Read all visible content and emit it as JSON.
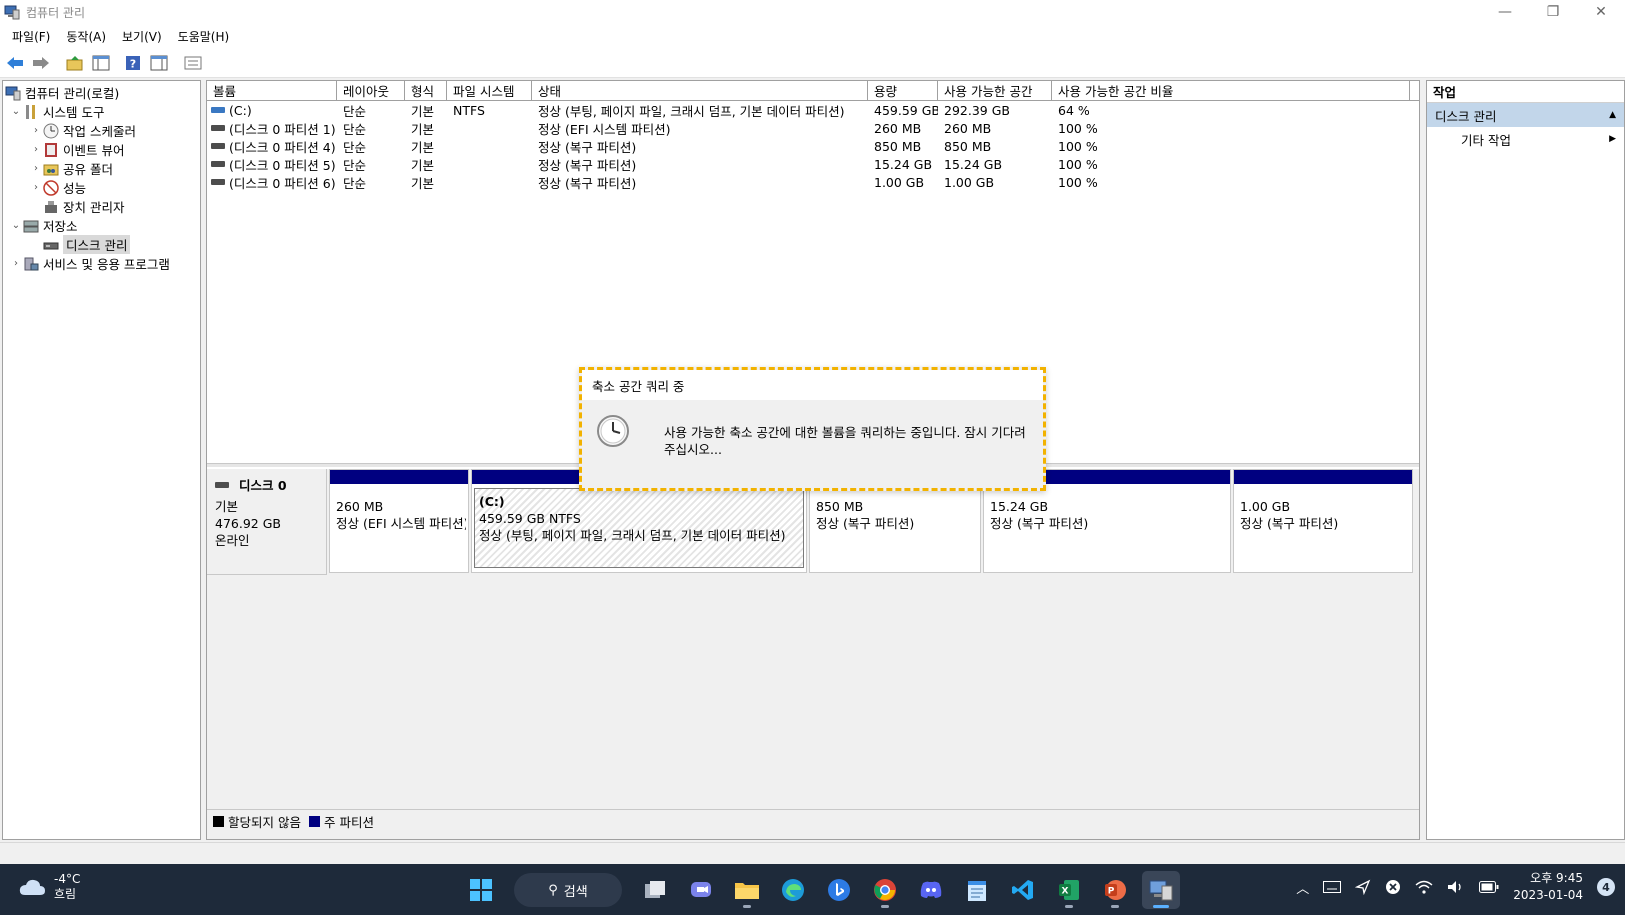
{
  "window": {
    "title": "컴퓨터 관리",
    "minimize": "—",
    "restore": "❐",
    "close": "✕"
  },
  "menu": [
    "파일(F)",
    "동작(A)",
    "보기(V)",
    "도움말(H)"
  ],
  "tree": {
    "root": "컴퓨터 관리(로컬)",
    "system_tools": "시스템 도구",
    "task_scheduler": "작업 스케줄러",
    "event_viewer": "이벤트 뷰어",
    "shared_folders": "공유 폴더",
    "performance": "성능",
    "device_manager": "장치 관리자",
    "storage": "저장소",
    "disk_management": "디스크 관리",
    "services_apps": "서비스 및 응용 프로그램"
  },
  "volumes": {
    "headers": [
      "볼륨",
      "레이아웃",
      "형식",
      "파일 시스템",
      "상태",
      "용량",
      "사용 가능한 공간",
      "사용 가능한 공간 비율"
    ],
    "rows": [
      [
        "(C:)",
        "단순",
        "기본",
        "NTFS",
        "정상 (부팅, 페이지 파일, 크래시 덤프, 기본 데이터 파티션)",
        "459.59 GB",
        "292.39 GB",
        "64 %"
      ],
      [
        "(디스크 0 파티션 1)",
        "단순",
        "기본",
        "",
        "정상 (EFI 시스템 파티션)",
        "260 MB",
        "260 MB",
        "100 %"
      ],
      [
        "(디스크 0 파티션 4)",
        "단순",
        "기본",
        "",
        "정상 (복구 파티션)",
        "850 MB",
        "850 MB",
        "100 %"
      ],
      [
        "(디스크 0 파티션 5)",
        "단순",
        "기본",
        "",
        "정상 (복구 파티션)",
        "15.24 GB",
        "15.24 GB",
        "100 %"
      ],
      [
        "(디스크 0 파티션 6)",
        "단순",
        "기본",
        "",
        "정상 (복구 파티션)",
        "1.00 GB",
        "1.00 GB",
        "100 %"
      ]
    ]
  },
  "disk": {
    "name": "디스크 0",
    "type": "기본",
    "size": "476.92 GB",
    "status": "온라인",
    "partitions": [
      {
        "name": "",
        "size": "260 MB",
        "status": "정상 (EFI 시스템 파티션)"
      },
      {
        "name": "(C:)",
        "size": "459.59 GB NTFS",
        "status": "정상 (부팅, 페이지 파일, 크래시 덤프, 기본 데이터 파티션)"
      },
      {
        "name": "",
        "size": "850 MB",
        "status": "정상 (복구 파티션)"
      },
      {
        "name": "",
        "size": "15.24 GB",
        "status": "정상 (복구 파티션)"
      },
      {
        "name": "",
        "size": "1.00 GB",
        "status": "정상 (복구 파티션)"
      }
    ]
  },
  "legend": {
    "unallocated": "할당되지 않음",
    "primary": "주 파티션",
    "unallocated_color": "#000000",
    "primary_color": "#000080"
  },
  "actions": {
    "header": "작업",
    "section": "디스크 관리",
    "more": "기타 작업"
  },
  "dialog": {
    "title": "축소 공간 쿼리 중",
    "message": "사용 가능한 축소 공간에 대한 볼륨을 쿼리하는 중입니다. 잠시 기다려 주십시오..."
  },
  "taskbar": {
    "temp": "-4°C",
    "weather": "흐림",
    "search": "검색",
    "time": "오후 9:45",
    "date": "2023-01-04",
    "notifications": "4"
  },
  "colors": {
    "accent": "#c2d6ea",
    "primary_partition": "#000080",
    "dialog_border": "#f2b200",
    "taskbar": "#1e2a3a"
  }
}
